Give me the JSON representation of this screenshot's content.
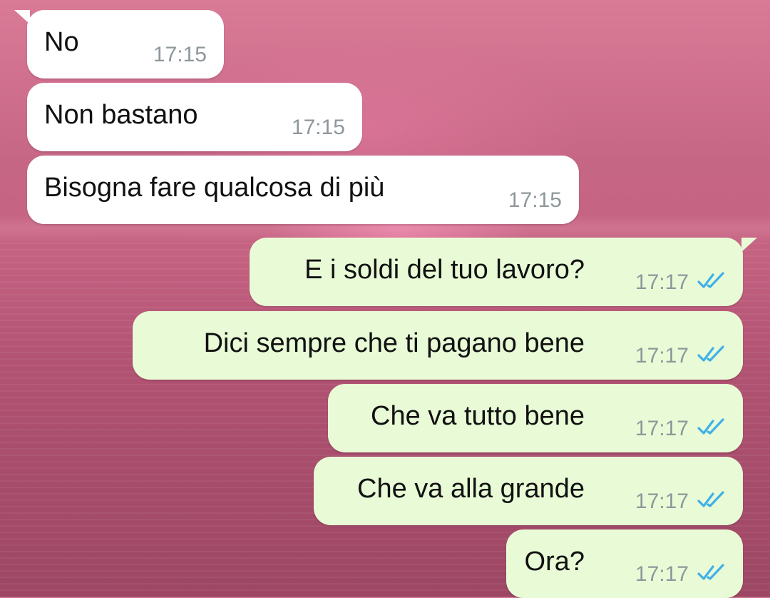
{
  "messages": {
    "incoming": [
      {
        "text": "No",
        "time": "17:15"
      },
      {
        "text": "Non bastano",
        "time": "17:15"
      },
      {
        "text": "Bisogna fare qualcosa di più",
        "time": "17:15"
      }
    ],
    "outgoing": [
      {
        "text": "E i soldi del tuo lavoro?",
        "time": "17:17",
        "status": "read"
      },
      {
        "text": "Dici sempre che ti pagano bene",
        "time": "17:17",
        "status": "read"
      },
      {
        "text": "Che va tutto bene",
        "time": "17:17",
        "status": "read"
      },
      {
        "text": "Che va alla grande",
        "time": "17:17",
        "status": "read"
      },
      {
        "text": "Ora?",
        "time": "17:17",
        "status": "read"
      }
    ]
  },
  "colors": {
    "incoming_bubble": "#ffffff",
    "outgoing_bubble": "#e8fbd6",
    "read_ticks": "#3fb0e8",
    "timestamp": "#8e979b"
  },
  "icons": {
    "status": "double-check-icon"
  }
}
